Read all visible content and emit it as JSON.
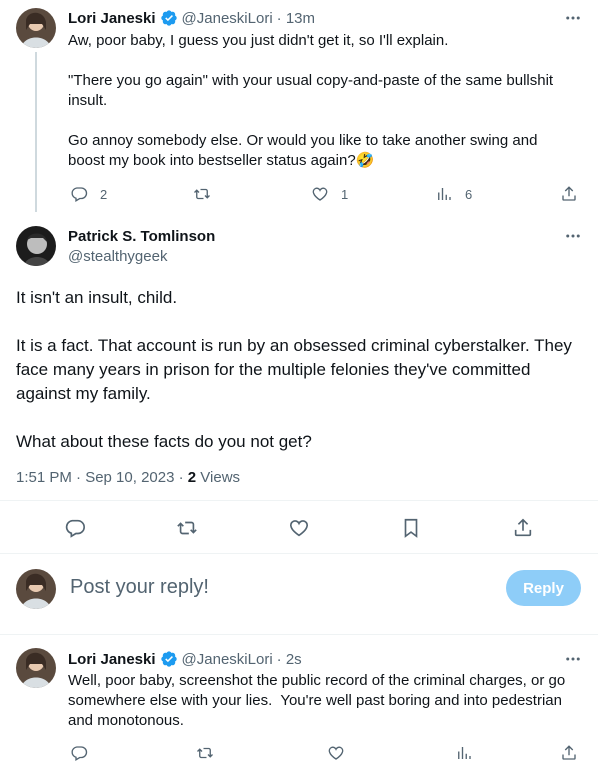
{
  "tweet1": {
    "name": "Lori Janeski",
    "handle": "@JaneskiLori",
    "time": "· 13m",
    "text": "Aw, poor baby, I guess you just didn't get it, so I'll explain.\n\n\"There you go again\" with your usual copy-and-paste of the same bullshit insult.\n\nGo annoy somebody else. Or would you like to take another swing and boost my book into bestseller status again?🤣",
    "replies": "2",
    "retweets": "",
    "likes": "1",
    "views": "6"
  },
  "main_tweet": {
    "name": "Patrick S. Tomlinson",
    "handle": "@stealthygeek",
    "text": "It isn't an insult, child.\n\nIt is a fact. That account is run by an obsessed criminal cyberstalker. They face many years in prison for the multiple felonies they've committed against my family.\n\nWhat about these facts do you not get?",
    "timestamp": "1:51 PM · Sep 10, 2023 · ",
    "views_count": "2",
    "views_label": " Views"
  },
  "composer": {
    "placeholder": "Post your reply!",
    "reply_label": "Reply"
  },
  "tweet3": {
    "name": "Lori Janeski",
    "handle": "@JaneskiLori",
    "time": "· 2s",
    "text": "Well, poor baby, screenshot the public record of the criminal charges, or go somewhere else with your lies.  You're well past boring and into pedestrian and monotonous."
  },
  "colors": {
    "accent": "#1d9bf0",
    "reply_button_disabled": "#8ecdf8",
    "secondary_text": "#536471",
    "divider": "#eff3f4"
  },
  "icons": [
    "more-icon",
    "verified-badge-icon",
    "reply-icon",
    "retweet-icon",
    "like-icon",
    "views-icon",
    "share-icon",
    "bookmark-icon"
  ]
}
